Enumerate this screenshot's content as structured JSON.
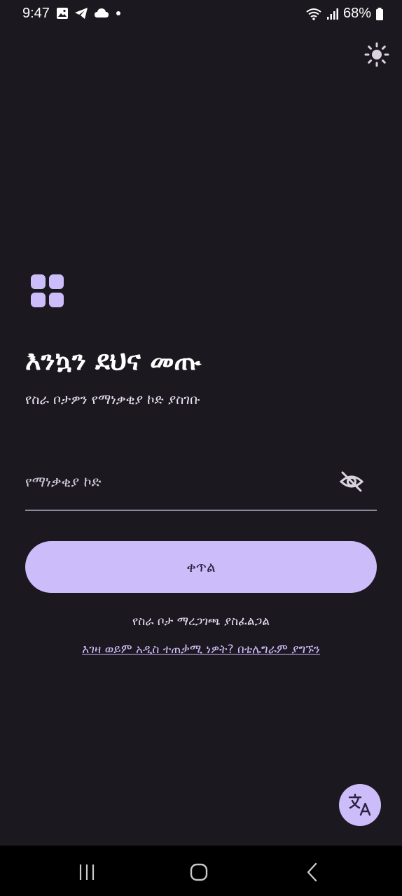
{
  "status_bar": {
    "time": "9:47",
    "battery": "68%",
    "left_icons": [
      "gallery-icon",
      "telegram-icon",
      "cloud-icon",
      "dot-icon"
    ],
    "right_icons": [
      "wifi-icon",
      "signal-icon",
      "battery-icon"
    ]
  },
  "header": {
    "theme_toggle_icon": "sun-icon"
  },
  "login": {
    "logo_icon": "grid-logo-icon",
    "title": "እንኳን ደህና መጡ",
    "subtitle": "የስራ ቦታዎን የማነቃቂያ ኮድ ያስገቡ",
    "code_placeholder": "የማነቃቂያ ኮድ",
    "code_value": "",
    "visibility_icon": "eye-off-icon",
    "continue_label": "ቀጥል",
    "workspace_note": "የስራ ቦታ ማረጋገጫ ያስፈልጋል",
    "telegram_link": "እገዛ ወይም አዲስ ተጠቃሚ ነዎት? በቴሌግራም ያግኙን"
  },
  "fab": {
    "icon": "translate-icon"
  },
  "nav_bar": {
    "items": [
      "recents-icon",
      "home-icon",
      "back-icon"
    ]
  },
  "colors": {
    "background": "#1c1820",
    "accent": "#cdbcfa",
    "on_accent": "#2c2240"
  }
}
